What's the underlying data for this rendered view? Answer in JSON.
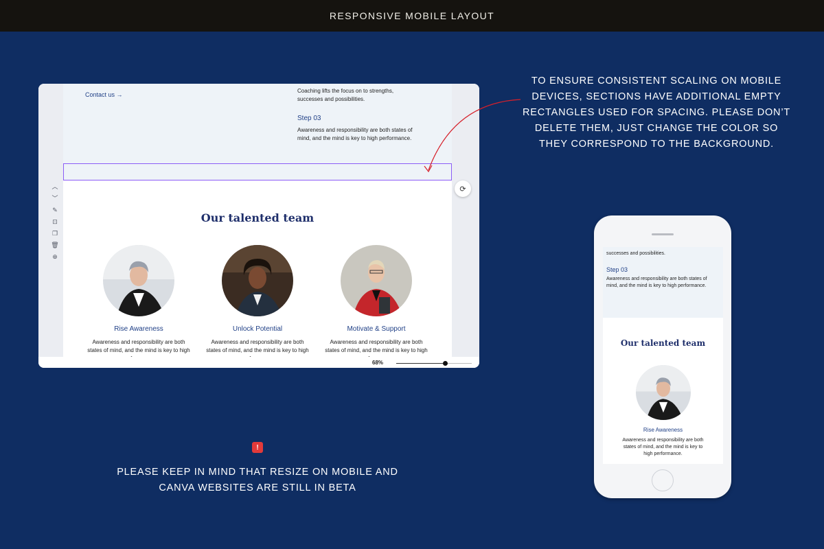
{
  "header": {
    "title": "RESPONSIVE MOBILE LAYOUT"
  },
  "editor": {
    "contact_link": "Contact us →",
    "coach_text": "Coaching lifts the focus on to strengths, successes and possibilities.",
    "step_title": "Step 03",
    "step_text": "Awareness and responsibility are both states of mind, and the mind is key to high performance.",
    "team_heading": "Our talented team",
    "members": [
      {
        "name": "Rise Awareness",
        "desc": "Awareness and responsibility are both states of mind, and the mind is key to high performance."
      },
      {
        "name": "Unlock Potential",
        "desc": "Awareness and responsibility are both states of mind, and the mind is key to high performance."
      },
      {
        "name": "Motivate & Support",
        "desc": "Awareness and responsibility are both states of mind, and the mind is key to high performance."
      }
    ],
    "zoom": {
      "label": "68%",
      "value": 0.68
    },
    "side_tools": [
      "chevron-up-icon",
      "chevron-down-icon",
      "notes-icon",
      "lock-icon",
      "duplicate-icon",
      "trash-icon",
      "add-page-icon"
    ],
    "spacer_color": "#8b5cf6"
  },
  "annotation": {
    "text": "TO ENSURE CONSISTENT SCALING ON MOBILE DEVICES, SECTIONS HAVE ADDITIONAL EMPTY RECTANGLES USED FOR SPACING. PLEASE DON’T DELETE THEM, JUST CHANGE THE COLOR SO THEY CORRESPOND TO THE BACKGROUND.",
    "arrow_color": "#d6202a"
  },
  "warning": {
    "icon": "siren-icon",
    "text": "PLEASE KEEP IN MIND THAT RESIZE ON MOBILE AND CANVA WEBSITES ARE STILL IN BETA"
  },
  "phone": {
    "top_text": "successes and possibilities.",
    "step_title": "Step 03",
    "step_text": "Awareness and responsibility are both states of mind, and the mind is key to high performance.",
    "team_heading": "Our talented team",
    "member_name": "Rise Awareness",
    "member_desc": "Awareness and responsibility are both states of mind, and the mind is key to high performance."
  },
  "colors": {
    "background": "#0f2d62",
    "topbar": "#15130f",
    "accent_blue": "#1f3f86",
    "section_bg": "#eef3f8"
  }
}
